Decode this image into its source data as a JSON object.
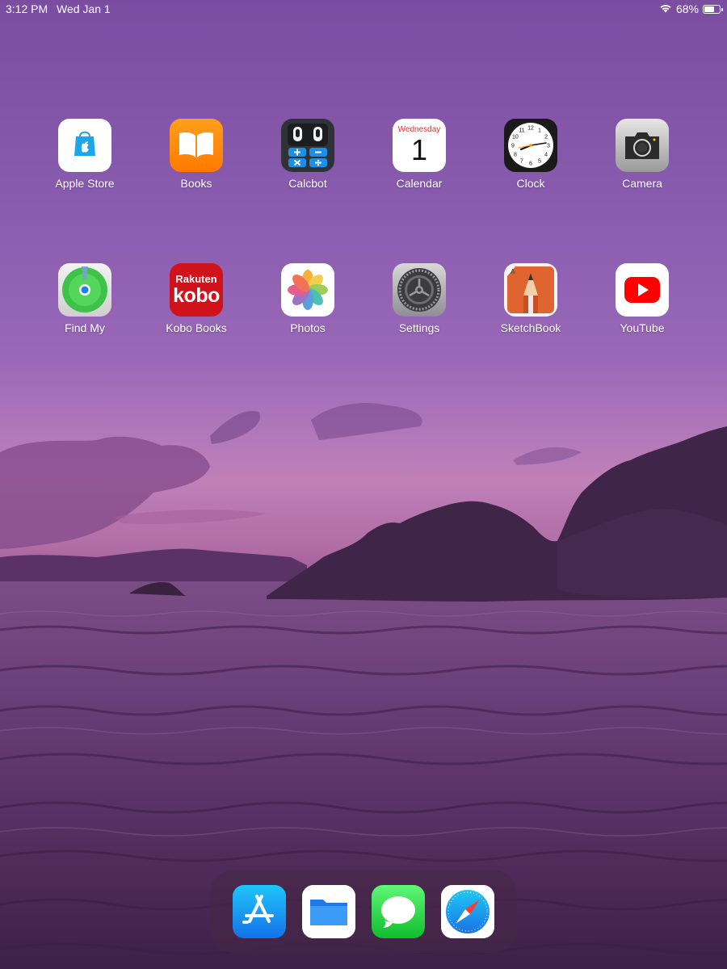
{
  "status_bar": {
    "time": "3:12 PM",
    "date": "Wed Jan 1",
    "wifi_icon": "wifi-icon",
    "battery_percent": "68%",
    "battery_level": 0.68
  },
  "apps": [
    {
      "id": "apple-store",
      "label": "Apple Store",
      "icon": "apple-store-icon"
    },
    {
      "id": "books",
      "label": "Books",
      "icon": "books-icon"
    },
    {
      "id": "calcbot",
      "label": "Calcbot",
      "icon": "calcbot-icon"
    },
    {
      "id": "calendar",
      "label": "Calendar",
      "icon": "calendar-icon",
      "day": "Wednesday",
      "date_number": "1"
    },
    {
      "id": "clock",
      "label": "Clock",
      "icon": "clock-icon",
      "numerals": [
        "12",
        "1",
        "2",
        "3",
        "4",
        "5",
        "6",
        "7",
        "8",
        "9",
        "10",
        "11"
      ]
    },
    {
      "id": "camera",
      "label": "Camera",
      "icon": "camera-icon"
    },
    {
      "id": "find-my",
      "label": "Find My",
      "icon": "find-my-icon"
    },
    {
      "id": "kobo-books",
      "label": "Kobo Books",
      "icon": "kobo-icon",
      "logo_text": [
        "Rakuten",
        "kobo"
      ]
    },
    {
      "id": "photos",
      "label": "Photos",
      "icon": "photos-icon"
    },
    {
      "id": "settings",
      "label": "Settings",
      "icon": "settings-gear-icon"
    },
    {
      "id": "sketchbook",
      "label": "SketchBook",
      "icon": "sketchbook-pencil-icon"
    },
    {
      "id": "youtube",
      "label": "YouTube",
      "icon": "youtube-play-icon"
    }
  ],
  "dock": [
    {
      "id": "app-store",
      "icon": "app-store-icon"
    },
    {
      "id": "files",
      "icon": "files-folder-icon"
    },
    {
      "id": "messages",
      "icon": "messages-bubble-icon"
    },
    {
      "id": "safari",
      "icon": "safari-compass-icon"
    }
  ],
  "colors": {
    "wallpaper_sky": "#8a5cb0",
    "wallpaper_water": "#5c3168",
    "dock_background": "#46284680"
  }
}
